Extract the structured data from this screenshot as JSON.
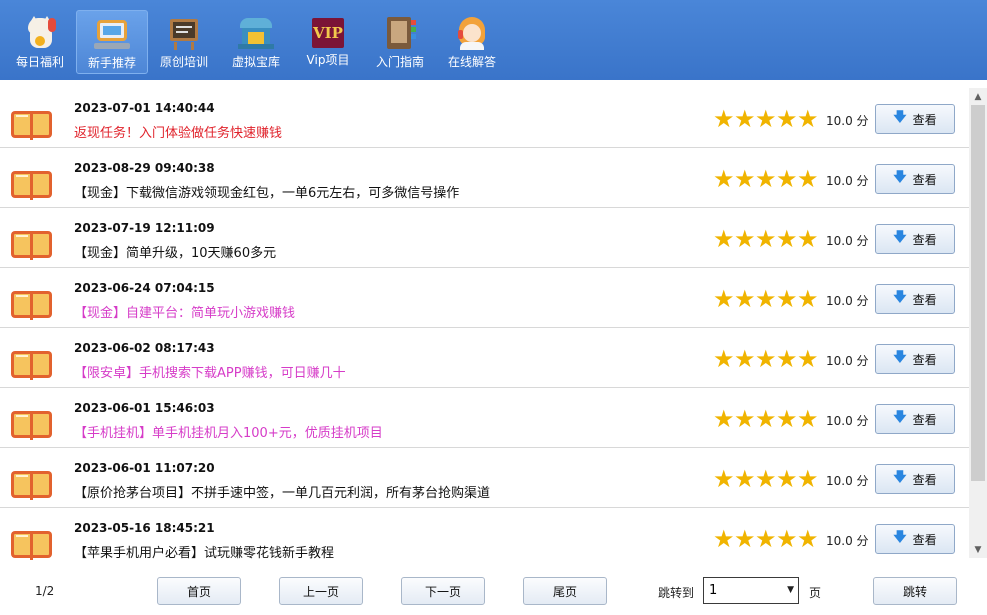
{
  "toolbar": {
    "items": [
      {
        "label": "每日福利",
        "icon": "lucky-cat-icon"
      },
      {
        "label": "新手推荐",
        "icon": "computer-icon",
        "active": true
      },
      {
        "label": "原创培训",
        "icon": "blackboard-icon"
      },
      {
        "label": "虚拟宝库",
        "icon": "treasury-icon"
      },
      {
        "label": "Vip项目",
        "icon": "vip-icon",
        "badge": "VIP"
      },
      {
        "label": "入门指南",
        "icon": "guide-book-icon"
      },
      {
        "label": "在线解答",
        "icon": "customer-service-icon"
      }
    ]
  },
  "list": {
    "stars": "★★★★★",
    "view_label": "查看",
    "items": [
      {
        "date": "2023-07-01 14:40:44",
        "title": "返现任务！入门体验做任务快速赚钱",
        "score": "10.0 分",
        "color": "#e0222b"
      },
      {
        "date": "2023-08-29 09:40:38",
        "title": "【现金】下载微信游戏领现金红包，一单6元左右，可多微信号操作",
        "score": "10.0 分",
        "color": "#111111"
      },
      {
        "date": "2023-07-19 12:11:09",
        "title": "【现金】简单升级，10天赚60多元",
        "score": "10.0 分",
        "color": "#111111"
      },
      {
        "date": "2023-06-24 07:04:15",
        "title": "【现金】自建平台：简单玩小游戏赚钱",
        "score": "10.0 分",
        "color": "#d63cc8"
      },
      {
        "date": "2023-06-02 08:17:43",
        "title": "【限安卓】手机搜索下载APP赚钱，可日赚几十",
        "score": "10.0 分",
        "color": "#d63cc8"
      },
      {
        "date": "2023-06-01 15:46:03",
        "title": "【手机挂机】单手机挂机月入100+元，优质挂机项目",
        "score": "10.0 分",
        "color": "#d63cc8"
      },
      {
        "date": "2023-06-01 11:07:20",
        "title": "【原价抢茅台项目】不拼手速中签，一单几百元利润，所有茅台抢购渠道",
        "score": "10.0 分",
        "color": "#111111"
      },
      {
        "date": "2023-05-16 18:45:21",
        "title": "【苹果手机用户必看】试玩赚零花钱新手教程",
        "score": "10.0 分",
        "color": "#111111"
      }
    ]
  },
  "footer": {
    "page_info": "1/2",
    "first": "首页",
    "prev": "上一页",
    "next": "下一页",
    "last": "尾页",
    "jump_label": "跳转到",
    "jump_value": "1",
    "page_unit": "页",
    "jump_button": "跳转"
  }
}
